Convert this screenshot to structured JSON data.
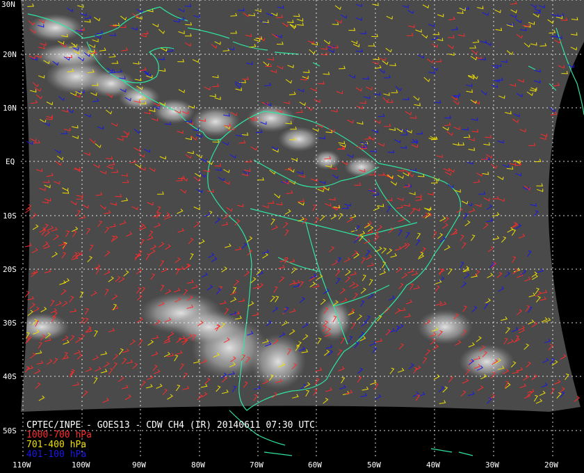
{
  "title": "CPTEC/INPE - GOES13 - CDW CH4 (IR) 20140611 07:30 UTC",
  "legend": [
    {
      "label": "1000-700 hPa",
      "color": "#ff2a2a"
    },
    {
      "label": "701-400 hPa",
      "color": "#f0e000"
    },
    {
      "label": "401-100 hPa",
      "color": "#1818e8"
    }
  ],
  "lat_labels": [
    "30N",
    "20N",
    "10N",
    "EQ",
    "10S",
    "20S",
    "30S",
    "40S",
    "50S"
  ],
  "lon_labels": [
    "110W",
    "100W",
    "90W",
    "80W",
    "70W",
    "60W",
    "50W",
    "40W",
    "30W",
    "20W"
  ],
  "colors": {
    "background": "#000000",
    "coastline": "#2ee6a0",
    "grid": "#ffffff",
    "imagery": "#4a4a4a"
  }
}
